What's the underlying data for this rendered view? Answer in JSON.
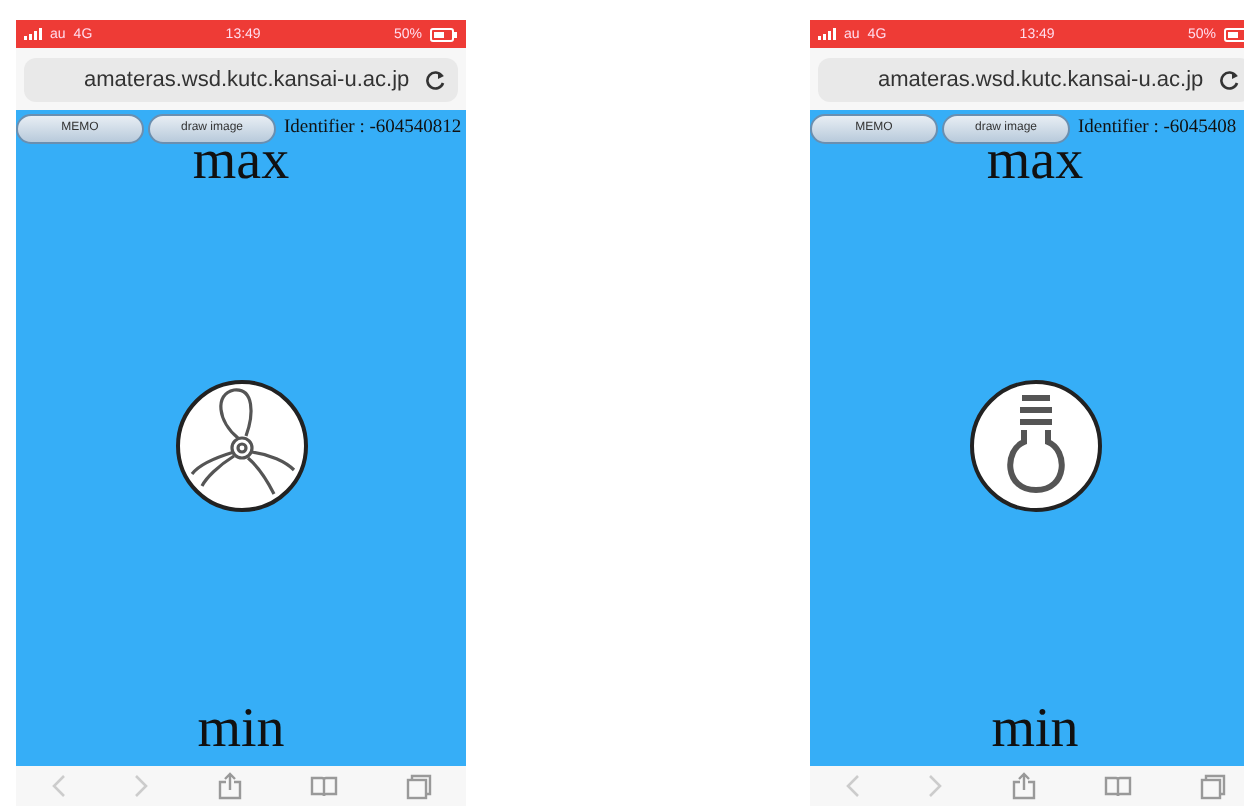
{
  "phones": [
    {
      "status": {
        "carrier": "au",
        "network": "4G",
        "time": "13:49",
        "battery": "50%"
      },
      "url": "amateras.wsd.kutc.kansai-u.ac.jp",
      "buttons": [
        "MEMO",
        "draw image"
      ],
      "identifier": "Identifier : -604540812",
      "max_label": "max",
      "min_label": "min",
      "device": {
        "kind": "fan"
      }
    },
    {
      "status": {
        "carrier": "au",
        "network": "4G",
        "time": "13:49",
        "battery": "50%"
      },
      "url": "amateras.wsd.kutc.kansai-u.ac.jp",
      "buttons": [
        "MEMO",
        "draw image"
      ],
      "identifier": "Identifier : -6045408",
      "max_label": "max",
      "min_label": "min",
      "device": {
        "kind": "bulb"
      }
    }
  ]
}
